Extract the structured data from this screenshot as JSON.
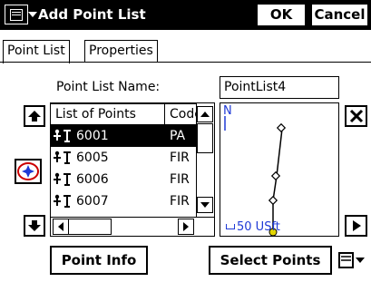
{
  "window": {
    "title": "Add Point List",
    "ok_label": "OK",
    "cancel_label": "Cancel"
  },
  "tabs": [
    {
      "label": "Point List",
      "active": true
    },
    {
      "label": "Properties",
      "active": false
    }
  ],
  "form": {
    "name_label": "Point List Name:",
    "name_value": "PointList4"
  },
  "list": {
    "columns": [
      "List of Points",
      "Code"
    ],
    "rows": [
      {
        "point": "6001",
        "code": "PA",
        "selected": true
      },
      {
        "point": "6005",
        "code": "FIR",
        "selected": false
      },
      {
        "point": "6006",
        "code": "FIR",
        "selected": false
      },
      {
        "point": "6007",
        "code": "FIR",
        "selected": false
      }
    ]
  },
  "map": {
    "north_label": "N",
    "scale_label": "50 USft"
  },
  "buttons": {
    "point_info": "Point Info",
    "select_points": "Select Points"
  },
  "icons": [
    "menu-icon",
    "move-up-icon",
    "move-down-icon",
    "select-on-map-icon",
    "delete-icon",
    "next-icon",
    "point-icon"
  ],
  "colors": {
    "titlebar": "#000000",
    "map_text": "#1f3ad6",
    "map_endpoint": "#e3d600"
  }
}
